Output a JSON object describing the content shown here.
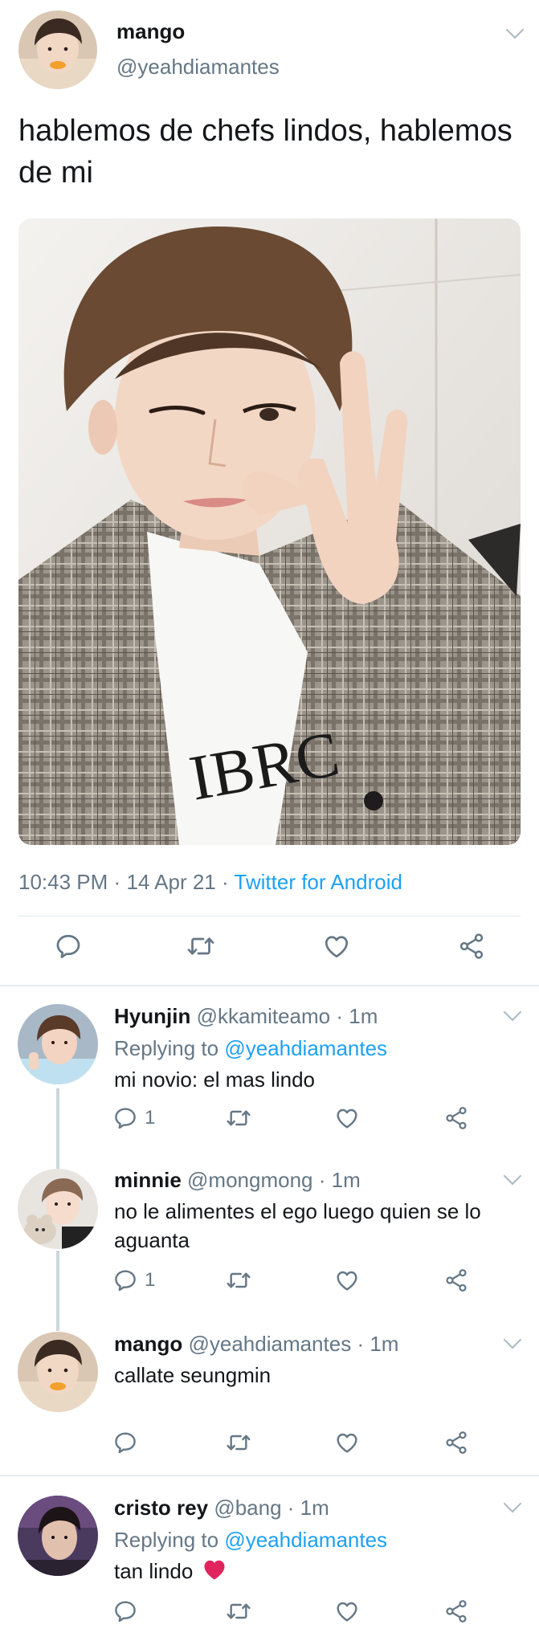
{
  "tweet": {
    "name": "mango",
    "handle": "@yeahdiamantes",
    "text": "hablemos de chefs lindos, hablemos de mi",
    "time": "10:43 PM",
    "date": "14 Apr 21",
    "sep": "·",
    "source": "Twitter for Android",
    "photo_icon": "selfie-photo"
  },
  "icons": {
    "reply": "reply-icon",
    "retweet": "retweet-icon",
    "like": "heart-icon",
    "share": "share-icon",
    "more": "chevron-down-icon"
  },
  "colors": {
    "link": "#1da1f2",
    "muted": "#657786",
    "text": "#14171a",
    "divider": "#e6ecf0",
    "heart_emoji": "#e0245e"
  },
  "replies": [
    {
      "name": "Hyunjin",
      "handle": "@kkamiteamo",
      "time": "· 1m",
      "replying_prefix": "Replying to",
      "replying_to": "@yeahdiamantes",
      "text": "mi novio: el mas lindo",
      "reply_count": "1"
    },
    {
      "name": "minnie",
      "handle": "@mongmong",
      "time": "· 1m",
      "text": "no le alimentes el ego luego quien se lo aguanta",
      "reply_count": "1"
    },
    {
      "name": "mango",
      "handle": "@yeahdiamantes",
      "time": "· 1m",
      "text": "callate seungmin"
    },
    {
      "name": "cristo rey",
      "handle": "@bang",
      "time": "· 1m",
      "replying_prefix": "Replying to",
      "replying_to": "@yeahdiamantes",
      "text": "tan lindo",
      "emoji": "red-heart-emoji"
    }
  ]
}
